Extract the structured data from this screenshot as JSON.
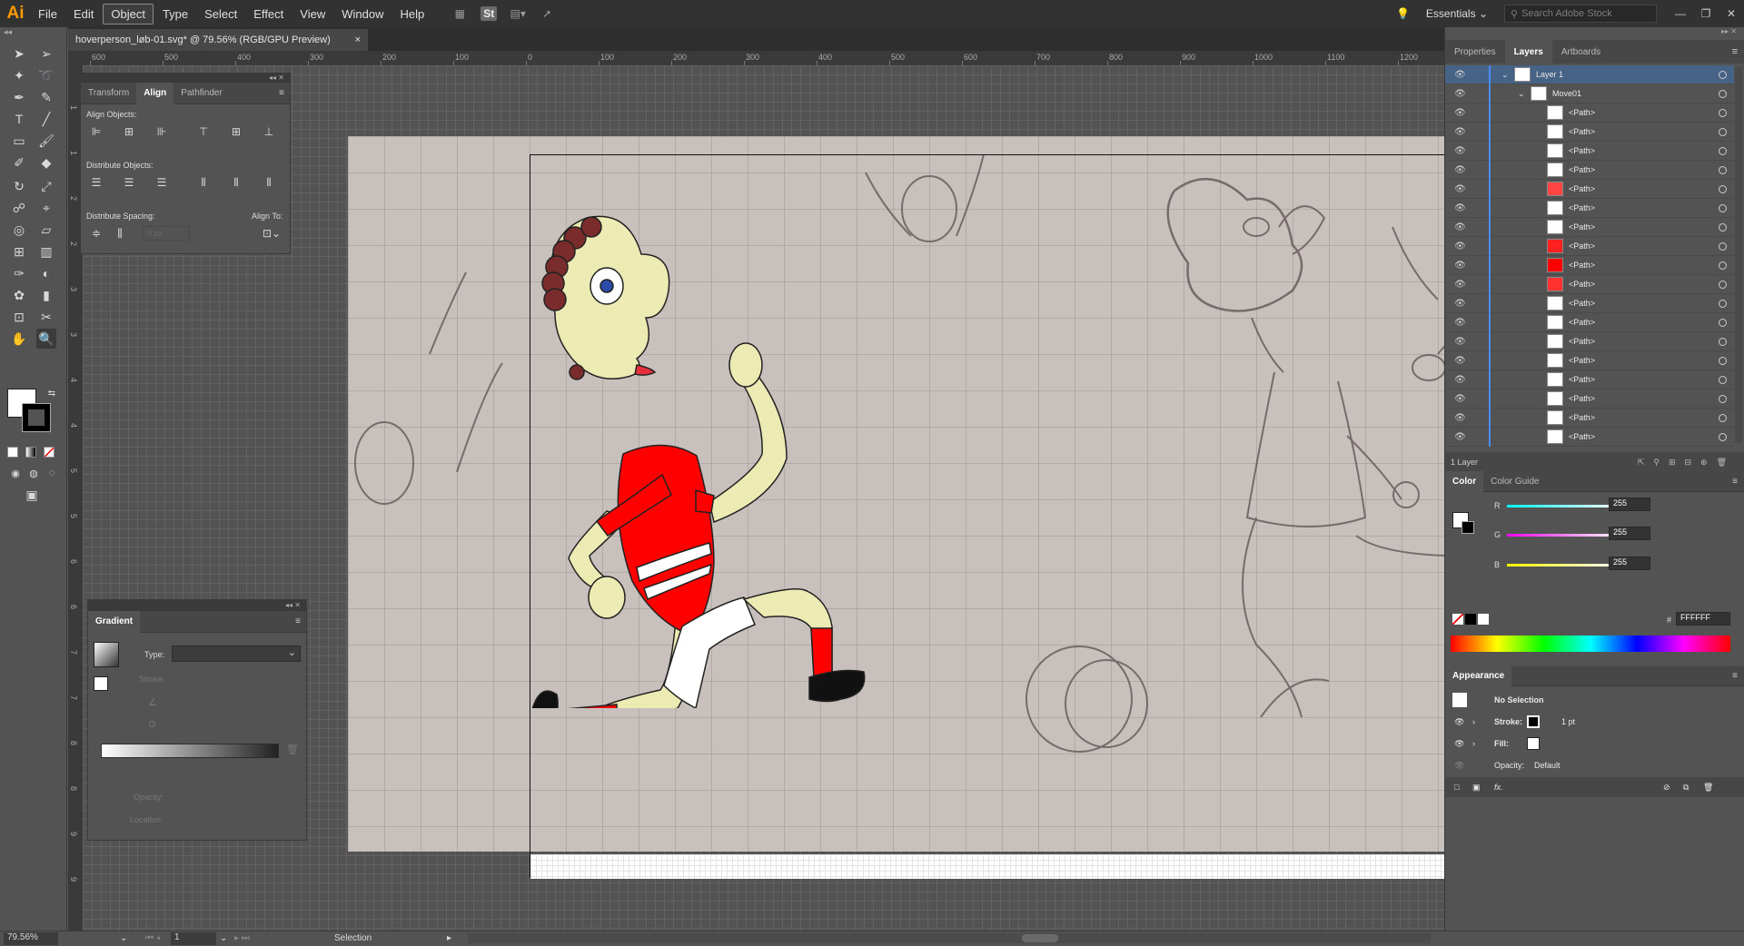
{
  "app": {
    "logo": "Ai"
  },
  "menu": [
    "File",
    "Edit",
    "Object",
    "Type",
    "Select",
    "Effect",
    "View",
    "Window",
    "Help"
  ],
  "menubar_right": {
    "workspace": "Essentials",
    "search_placeholder": "Search Adobe Stock",
    "st_label": "St"
  },
  "document": {
    "tab_title": "hoverperson_løb-01.svg* @ 79.56% (RGB/GPU Preview)",
    "close": "×"
  },
  "ruler": {
    "h": [
      "600",
      "500",
      "400",
      "300",
      "200",
      "100",
      "0",
      "100",
      "200",
      "300",
      "400",
      "500",
      "600",
      "700",
      "800",
      "900",
      "1000",
      "1100",
      "1200"
    ],
    "v": [
      "1",
      "1",
      "2",
      "2",
      "3",
      "3",
      "4",
      "4",
      "5",
      "5",
      "6",
      "6",
      "7",
      "7",
      "8",
      "8",
      "9",
      "9"
    ]
  },
  "align_panel": {
    "tabs": [
      "Transform",
      "Align",
      "Pathfinder"
    ],
    "align_objects": "Align Objects:",
    "distribute_objects": "Distribute Objects:",
    "distribute_spacing": "Distribute Spacing:",
    "align_to": "Align To:",
    "spacing_value": "0 px"
  },
  "gradient_panel": {
    "title": "Gradient",
    "type_label": "Type:",
    "stroke_label": "Stroke:",
    "opacity_label": "Opacity:",
    "location_label": "Location:"
  },
  "dock_tabs": [
    "Properties",
    "Layers",
    "Artboards"
  ],
  "layers": [
    {
      "name": "Layer 1",
      "level": 0
    },
    {
      "name": "Move01",
      "level": 1
    },
    {
      "name": "<Path>",
      "level": 2
    },
    {
      "name": "<Path>",
      "level": 2
    },
    {
      "name": "<Path>",
      "level": 2
    },
    {
      "name": "<Path>",
      "level": 2
    },
    {
      "name": "<Path>",
      "level": 2
    },
    {
      "name": "<Path>",
      "level": 2
    },
    {
      "name": "<Path>",
      "level": 2
    },
    {
      "name": "<Path>",
      "level": 2
    },
    {
      "name": "<Path>",
      "level": 2
    },
    {
      "name": "<Path>",
      "level": 2
    },
    {
      "name": "<Path>",
      "level": 2
    },
    {
      "name": "<Path>",
      "level": 2
    },
    {
      "name": "<Path>",
      "level": 2
    },
    {
      "name": "<Path>",
      "level": 2
    },
    {
      "name": "<Path>",
      "level": 2
    },
    {
      "name": "<Path>",
      "level": 2
    },
    {
      "name": "<Path>",
      "level": 2
    },
    {
      "name": "<Path>",
      "level": 2
    },
    {
      "name": "<Path>",
      "level": 2
    }
  ],
  "layers_footer": "1 Layer",
  "color_panel": {
    "tabs": [
      "Color",
      "Color Guide"
    ],
    "r_label": "R",
    "g_label": "G",
    "b_label": "B",
    "r": "255",
    "g": "255",
    "b": "255",
    "hex_label": "#",
    "hex": "FFFFFF"
  },
  "appearance_panel": {
    "title": "Appearance",
    "selection": "No Selection",
    "stroke_label": "Stroke:",
    "stroke_weight": "1 pt",
    "fill_label": "Fill:",
    "opacity_label": "Opacity:",
    "opacity_value": "Default",
    "fx": "fx."
  },
  "status": {
    "zoom": "79.56%",
    "artboard": "1",
    "tool": "Selection"
  },
  "colors": {
    "accent": "#466285",
    "shirt": "#ff0000",
    "skin": "#ecebb4",
    "hair": "#7a2b2b"
  }
}
